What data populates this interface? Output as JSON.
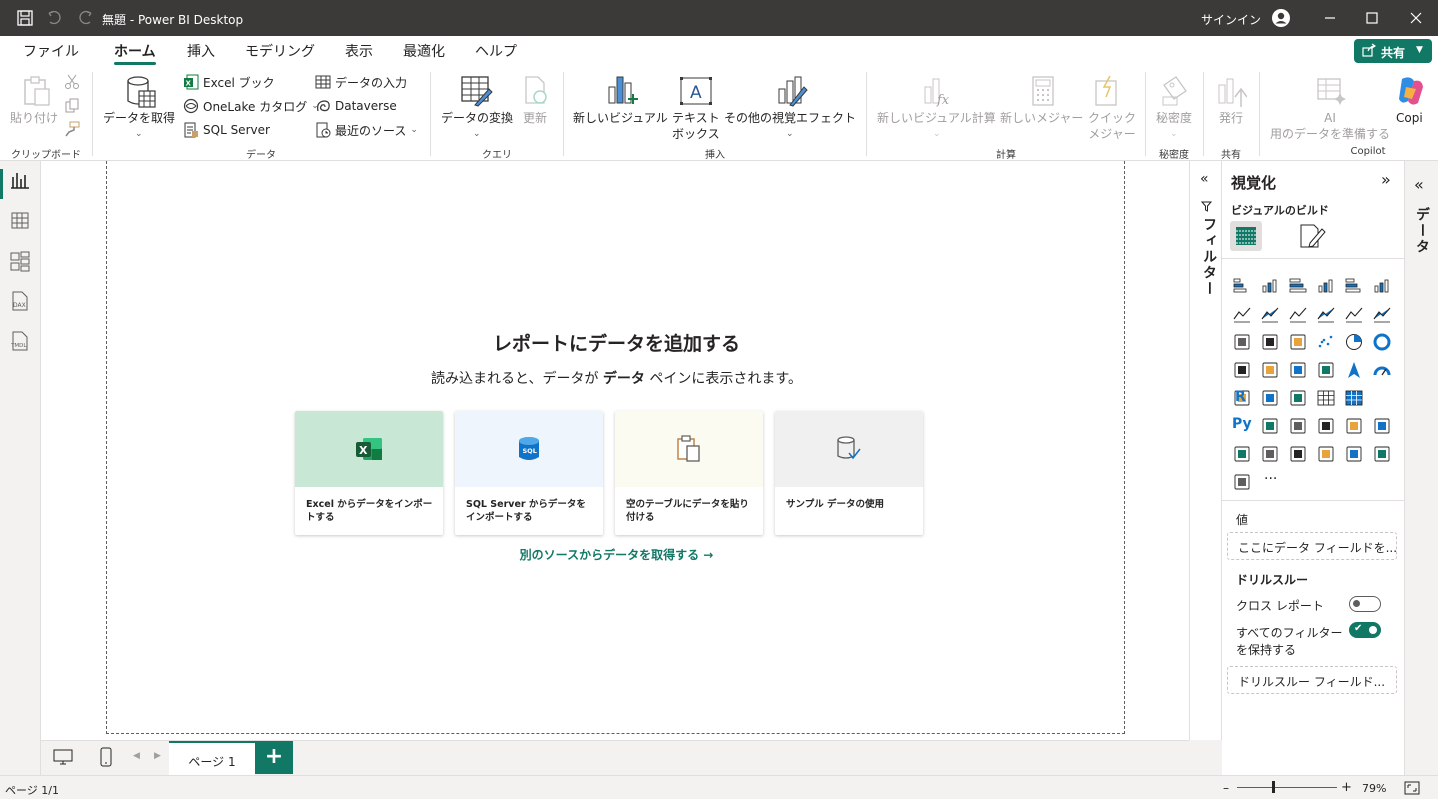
{
  "window": {
    "title": "無題 - Power BI Desktop",
    "signin": "サインイン"
  },
  "menu": {
    "tabs": [
      "ファイル",
      "ホーム",
      "挿入",
      "モデリング",
      "表示",
      "最適化",
      "ヘルプ"
    ],
    "share": "共有"
  },
  "ribbon": {
    "clipboard": {
      "paste": "貼り付け",
      "group": "クリップボード"
    },
    "data": {
      "get_data": "データを取得",
      "excel": "Excel ブック",
      "onelake": "OneLake カタログ",
      "sql": "SQL Server",
      "enter": "データの入力",
      "dataverse": "Dataverse",
      "recent": "最近のソース",
      "group": "データ"
    },
    "query": {
      "transform": "データの変換",
      "refresh": "更新",
      "group": "クエリ"
    },
    "insert": {
      "new_visual": "新しいビジュアル",
      "textbox_1": "テキスト",
      "textbox_2": "ボックス",
      "more_visuals": "その他の視覚エフェクト",
      "group": "挿入"
    },
    "calc": {
      "new_visual_calc": "新しいビジュアル計算",
      "new_measure": "新しいメジャー",
      "quick_1": "クイック",
      "quick_2": "メジャー",
      "group": "計算"
    },
    "sensitivity": {
      "label": "秘密度",
      "group": "秘密度"
    },
    "share": {
      "publish": "発行",
      "group": "共有"
    },
    "copilot": {
      "ai_1": "AI",
      "ai_2": "用のデータを準備する",
      "copilot": "Copi",
      "group": "Copilot"
    }
  },
  "canvas": {
    "heading": "レポートにデータを追加する",
    "sub_pre": "読み込まれると、データが ",
    "sub_bold": "データ",
    "sub_post": " ペインに表示されます。",
    "cards": [
      {
        "label": "Excel からデータをインポートする",
        "bg": "#c8e8d5"
      },
      {
        "label": "SQL Server からデータをインポートする",
        "bg": "#eef5fc"
      },
      {
        "label": "空のテーブルにデータを貼り付ける",
        "bg": "#fbfbf2"
      },
      {
        "label": "サンプル データの使用",
        "bg": "#f0f0f0"
      }
    ],
    "other_source": "別のソースからデータを取得する →"
  },
  "filters": {
    "label": "フィルター"
  },
  "viz": {
    "title": "視覚化",
    "build": "ビジュアルのビルド",
    "values": "値",
    "values_well": "ここにデータ フィールドを...",
    "drill": "ドリルスルー",
    "cross_report": "クロス レポート",
    "keep_filters_1": "すべてのフィルター",
    "keep_filters_2": "を保持する",
    "drill_well": "ドリルスルー フィールド...",
    "r_label": "R",
    "py_label": "Py",
    "more": "···"
  },
  "data_pane": {
    "label": "データ"
  },
  "pages": {
    "tab": "ページ 1",
    "add": "+"
  },
  "status": {
    "page": "ページ 1/1",
    "zoom": "79%"
  },
  "colors": {
    "accent": "#117865",
    "titlebar": "#3b3a39"
  }
}
